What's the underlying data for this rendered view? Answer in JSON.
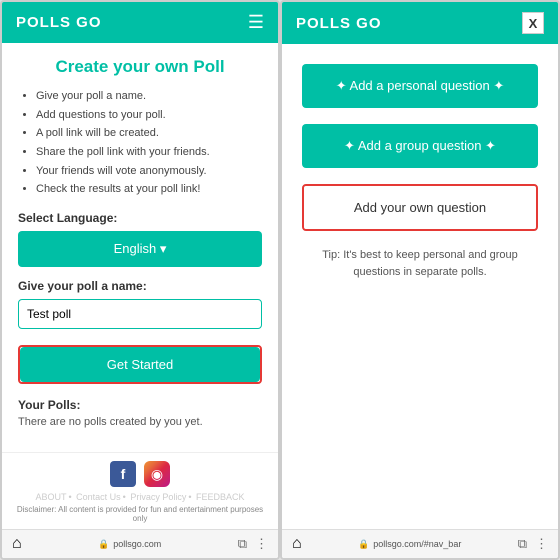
{
  "left_screen": {
    "header": {
      "logo": "POLLS GO",
      "menu_icon": "☰"
    },
    "title": "Create your own Poll",
    "bullets": [
      "Give your poll a name.",
      "Add questions to your poll.",
      "A poll link will be created.",
      "Share the poll link with your friends.",
      "Your friends will vote anonymously.",
      "Check the results at your poll link!"
    ],
    "language_label": "Select Language:",
    "language_value": "English ▾",
    "poll_name_label": "Give your poll a name:",
    "poll_name_placeholder": "Test poll",
    "get_started_label": "Get Started",
    "your_polls_title": "Your Polls:",
    "no_polls_text": "There are no polls created by you yet.",
    "footer": {
      "facebook_letter": "f",
      "instagram_icon": "◉",
      "links": [
        "ABOUT",
        "Contact Us",
        "Privacy Policy",
        "FEEDBACK"
      ],
      "disclaimer": "Disclaimer: All content is provided for fun and entertainment purposes only"
    },
    "bottom_bar": {
      "url": "pollsgo.com",
      "home_icon": "⌂",
      "lock_icon": "🔒",
      "tab_icon": "⧉",
      "more_icon": "⋮"
    }
  },
  "right_screen": {
    "header": {
      "logo": "POLLS GO",
      "close_label": "X"
    },
    "personal_question_btn": "✦ Add a personal question ✦",
    "group_question_btn": "✦ Add a group question ✦",
    "own_question_btn": "Add your own question",
    "tip_text": "Tip: It's best to keep personal and group questions in separate polls.",
    "bottom_bar": {
      "url": "pollsgo.com/#nav_bar",
      "home_icon": "⌂",
      "lock_icon": "🔒",
      "tab_icon": "⧉",
      "more_icon": "⋮"
    }
  }
}
